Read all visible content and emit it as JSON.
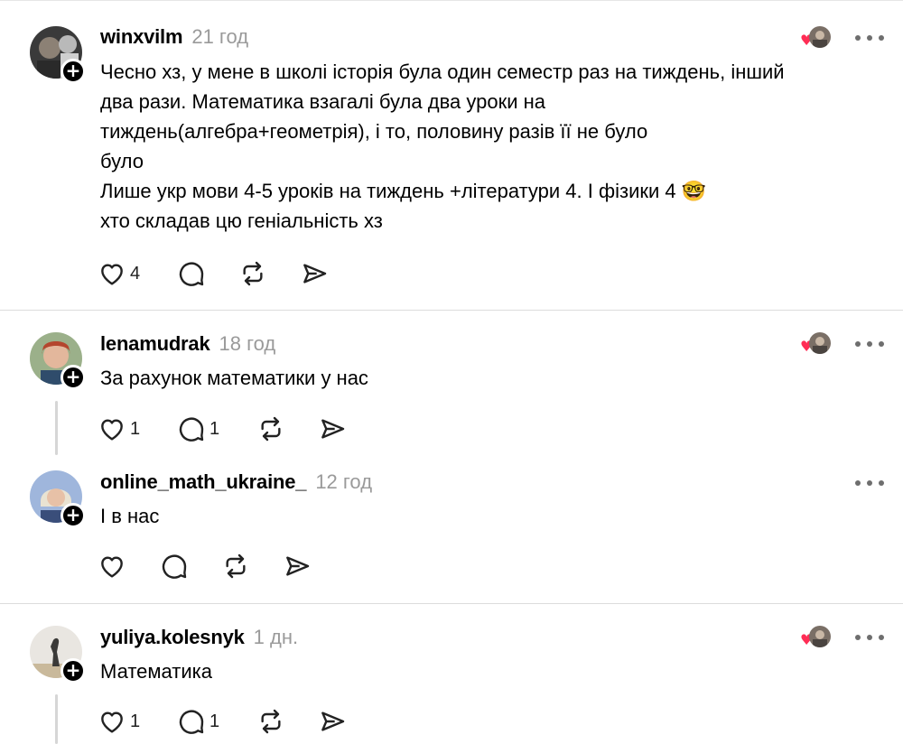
{
  "colors": {
    "heart": "#ff2d55",
    "time": "#9a9a9a",
    "text": "#000000",
    "divider": "#dcdcdc"
  },
  "posts": [
    {
      "username": "winxvilm",
      "time": "21 год",
      "lines": [
        "Чесно хз, у мене в школі історія була один семестр раз на тиждень, інший",
        "два рази. Математика взагалі була два уроки на",
        "тиждень(алгебра+геометрія), і то, половину разів її не було",
        "було",
        "Лише укр мови 4-5 уроків на тиждень +літератури 4. І фізики 4 🤓",
        "хто складав цю геніальність хз"
      ],
      "likes": "4",
      "replies": "",
      "has_liked_by": true
    },
    {
      "username": "lenamudrak",
      "time": "18 год",
      "lines": [
        "За рахунок математики у нас"
      ],
      "likes": "1",
      "replies": "1",
      "has_liked_by": true
    },
    {
      "username": "online_math_ukraine_",
      "time": "12 год",
      "lines": [
        "І в нас"
      ],
      "likes": "",
      "replies": "",
      "has_liked_by": false
    },
    {
      "username": "yuliya.kolesnyk",
      "time": "1 дн.",
      "lines": [
        "Математика"
      ],
      "likes": "1",
      "replies": "1",
      "has_liked_by": true
    }
  ],
  "icons": {
    "like": "heart-outline-icon",
    "reply": "speech-bubble-icon",
    "repost": "repost-arrows-icon",
    "share": "paper-plane-icon",
    "more": "ellipsis-icon",
    "follow": "plus-icon"
  },
  "follow_symbol": "+"
}
